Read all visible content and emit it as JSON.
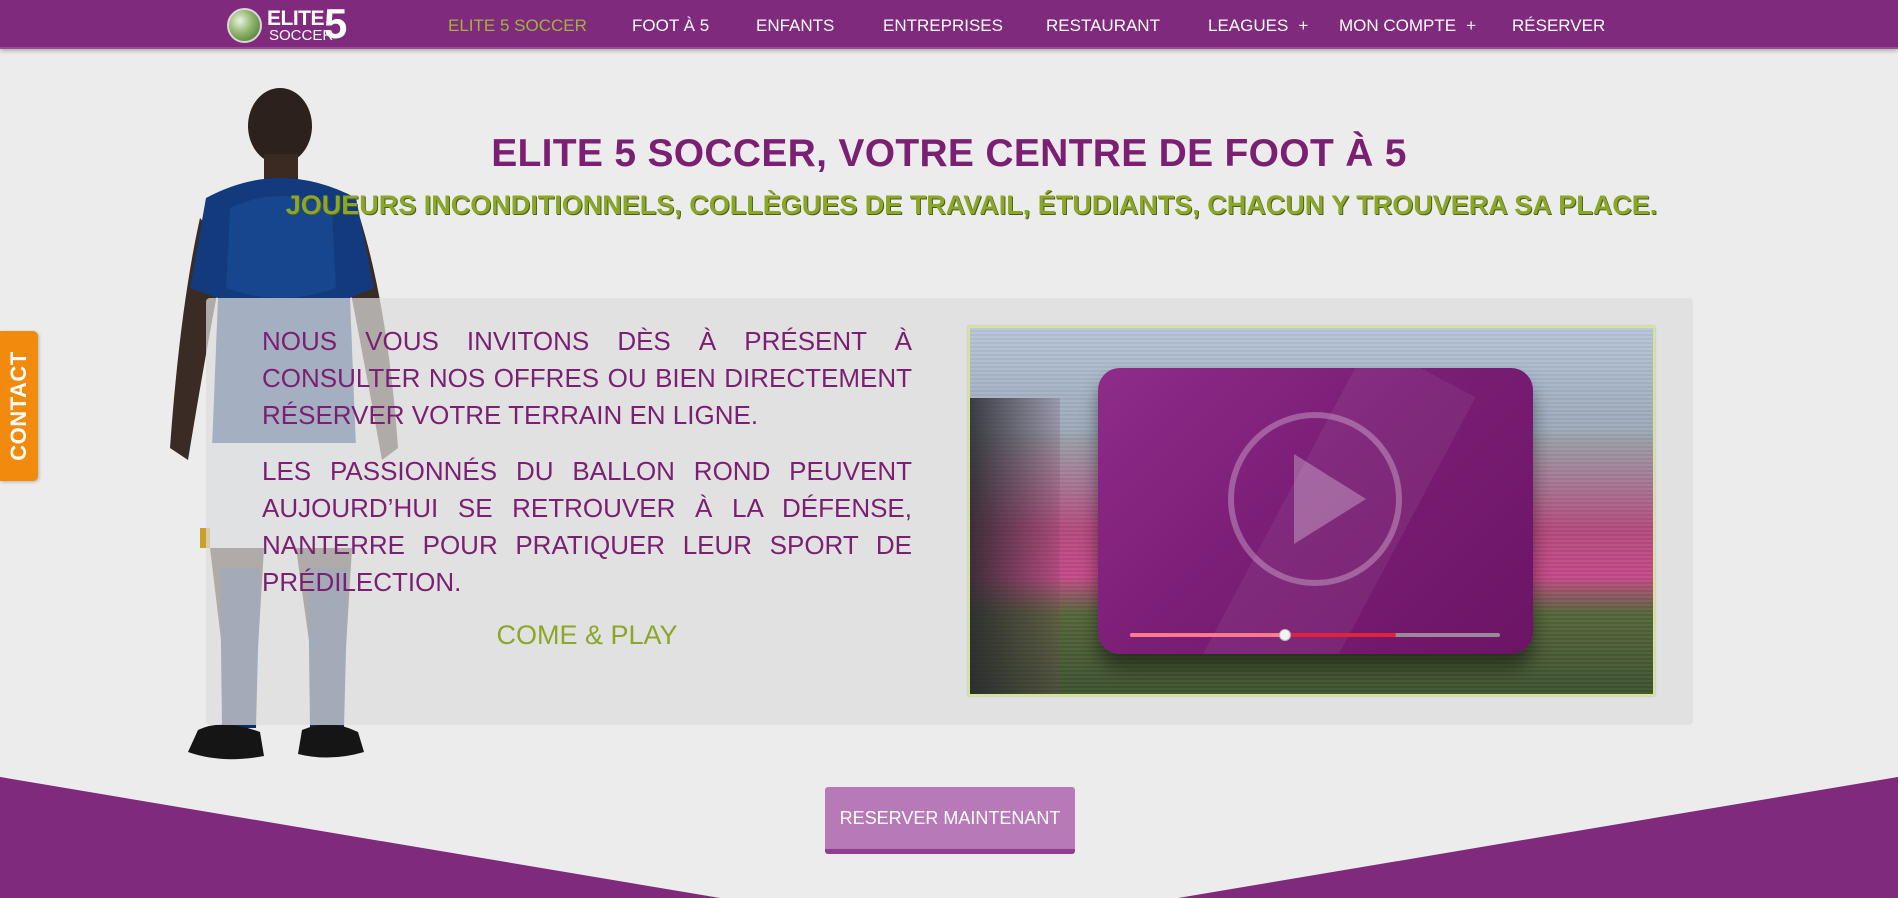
{
  "brand": {
    "logo_top": "ELITE",
    "logo_bottom": "SOCCER",
    "logo_number": "5",
    "primary_color": "#7f2a7c",
    "accent_color": "#8ba628",
    "contact_color": "#f28a0e"
  },
  "nav": {
    "items": [
      {
        "label": "ELITE 5 SOCCER",
        "active": true
      },
      {
        "label": "FOOT À 5"
      },
      {
        "label": "ENFANTS"
      },
      {
        "label": "ENTREPRISES"
      },
      {
        "label": "RESTAURANT"
      },
      {
        "label": "LEAGUES",
        "submenu": "+"
      },
      {
        "label": "MON COMPTE",
        "submenu": "+"
      },
      {
        "label": "RÉSERVER"
      }
    ]
  },
  "contact_tab": {
    "label": "CONTACT"
  },
  "hero": {
    "title": "ELITE 5 SOCCER, VOTRE CENTRE DE FOOT À 5",
    "subtitle": "JOUEURS INCONDITIONNELS, COLLÈGUES DE TRAVAIL, ÉTUDIANTS, CHACUN Y TROUVERA SA PLACE."
  },
  "content": {
    "paragraph_1": "NOUS VOUS INVITONS DÈS À PRÉSENT À CONSULTER NOS OFFRES OU BIEN DIRECTEMENT RÉSERVER VOTRE TERRAIN EN LIGNE.",
    "paragraph_2": "LES PASSIONNÉS DU BALLON ROND PEUVENT AUJOURD’HUI SE RETROUVER À LA DÉFENSE, NANTERRE POUR PRATIQUER LEUR SPORT DE PRÉDILECTION.",
    "tagline": "COME & PLAY"
  },
  "video": {
    "icon": "play-icon",
    "played_fraction": 0.42,
    "buffered_fraction": 0.72
  },
  "cta": {
    "label": "RESERVER MAINTENANT"
  }
}
